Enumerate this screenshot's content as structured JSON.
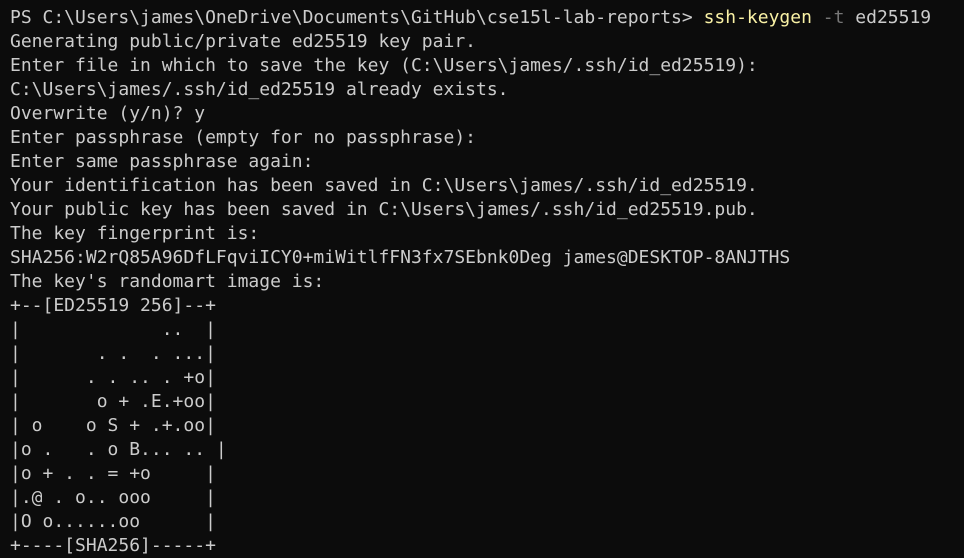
{
  "terminal": {
    "prompt": "PS C:\\Users\\james\\OneDrive\\Documents\\GitHub\\cse15l-lab-reports> ",
    "command": "ssh-keygen",
    "flag": " -t",
    "argument": " ed25519",
    "output_lines": [
      "Generating public/private ed25519 key pair.",
      "Enter file in which to save the key (C:\\Users\\james/.ssh/id_ed25519):",
      "C:\\Users\\james/.ssh/id_ed25519 already exists.",
      "Overwrite (y/n)? y",
      "Enter passphrase (empty for no passphrase):",
      "Enter same passphrase again:",
      "Your identification has been saved in C:\\Users\\james/.ssh/id_ed25519.",
      "Your public key has been saved in C:\\Users\\james/.ssh/id_ed25519.pub.",
      "The key fingerprint is:",
      "SHA256:W2rQ85A96DfLFqviICY0+miWitlfFN3fx7SEbnk0Deg james@DESKTOP-8ANJTHS",
      "The key's randomart image is:",
      "+--[ED25519 256]--+",
      "|             ..  |",
      "|       . .  . ...|",
      "|      . . .. . +o|",
      "|       o + .E.+oo|",
      "| o    o S + .+.oo|",
      "|o .   . o B... .. |",
      "|o + . . = +o     |",
      "|.@ . o.. ooo     |",
      "|O o......oo      |",
      "+----[SHA256]-----+"
    ]
  },
  "colors": {
    "background": "#0c0c0c",
    "text": "#cccccc",
    "command": "#f9f1a5",
    "flag": "#767676"
  }
}
